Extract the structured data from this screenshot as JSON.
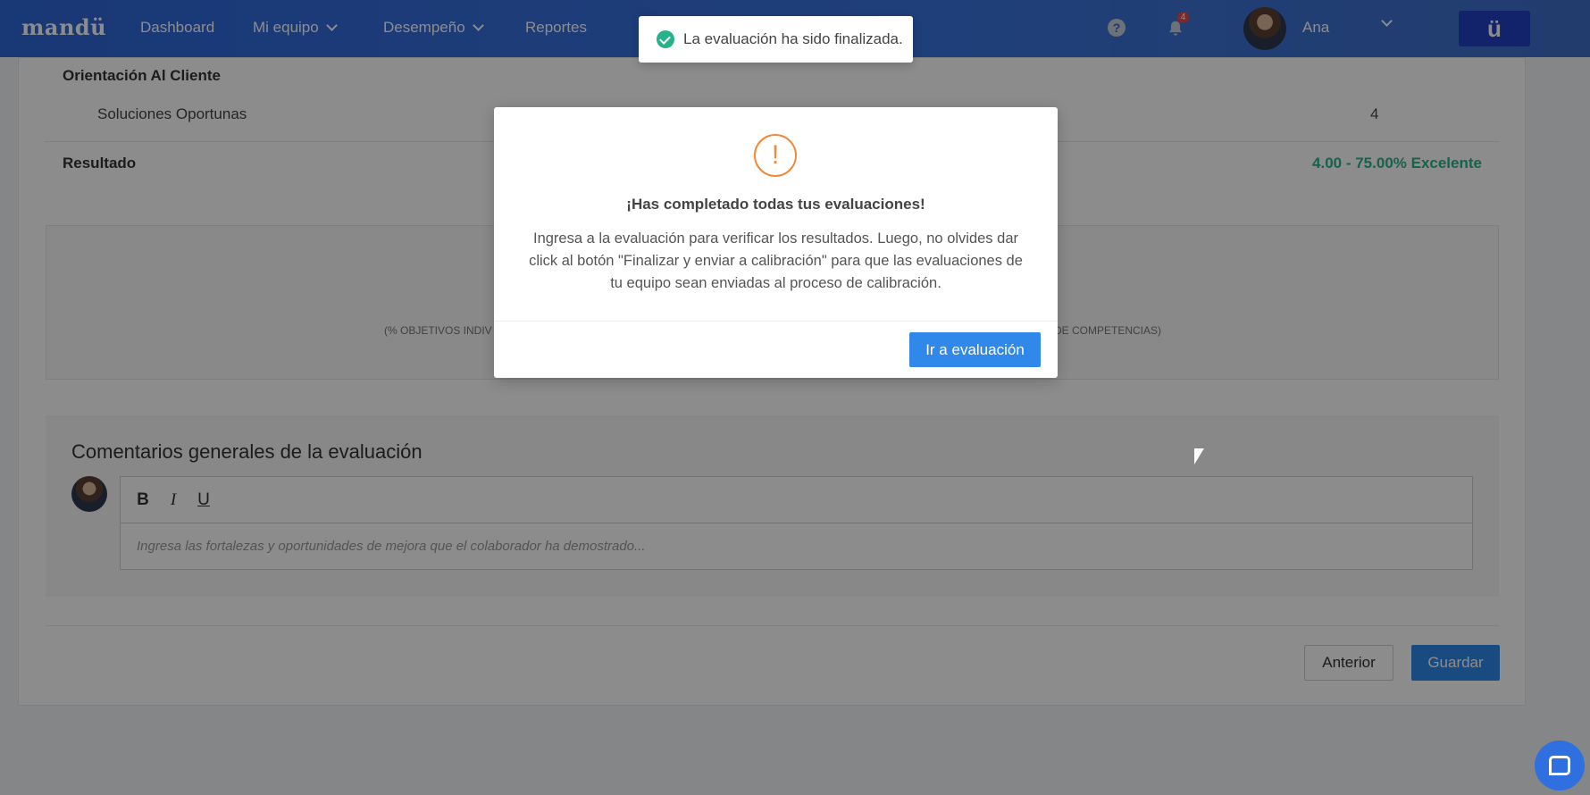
{
  "nav": {
    "logo": "mandü",
    "items": [
      {
        "label": "Dashboard"
      },
      {
        "label": "Mi equipo"
      },
      {
        "label": "Desempeño"
      },
      {
        "label": "Reportes"
      }
    ],
    "notifications_count": "4",
    "user_name": "Ana",
    "brand_button": "ü"
  },
  "toast": {
    "message": "La evaluación ha sido finalizada."
  },
  "competencies": {
    "section_title": "Orientación Al Cliente",
    "items": [
      {
        "label": "Soluciones Oportunas",
        "score": "4"
      }
    ],
    "result_label": "Resultado",
    "result_value": "4.00 - 75.00% Excelente"
  },
  "summary": {
    "left_text": "(% OBJETIVOS INDIV",
    "right_text": "DE COMPETENCIAS)"
  },
  "comments": {
    "title": "Comentarios generales de la evaluación",
    "toolbar": {
      "bold": "B",
      "italic": "I",
      "underline": "U"
    },
    "placeholder": "Ingresa las fortalezas y oportunidades de mejora que el colaborador ha demostrado..."
  },
  "footer": {
    "prev_label": "Anterior",
    "save_label": "Guardar"
  },
  "modal": {
    "icon": "!",
    "title": "¡Has completado todas tus evaluaciones!",
    "body": "Ingresa a la evaluación para verificar los resultados. Luego, no olvides dar click al botón \"Finalizar y enviar a calibración\" para que las evaluaciones de tu equipo sean enviadas al proceso de calibración.",
    "button_label": "Ir a evaluación"
  },
  "colors": {
    "primary": "#2f88ea",
    "success": "#26b28a",
    "warning": "#f08a3a",
    "result": "#2bb38a"
  }
}
